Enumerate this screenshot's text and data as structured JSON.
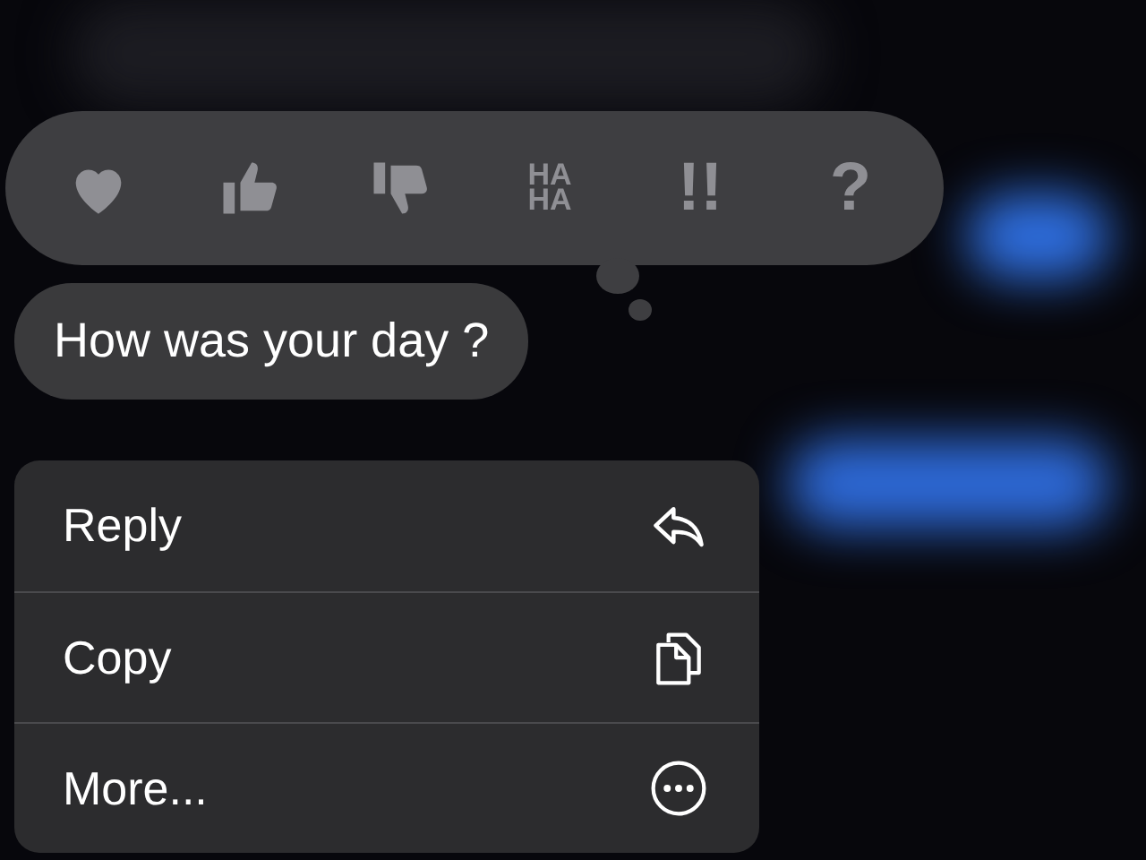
{
  "reactions": [
    {
      "kind": "heart"
    },
    {
      "kind": "thumbs-up"
    },
    {
      "kind": "thumbs-down"
    },
    {
      "kind": "text",
      "label": "HA HA"
    },
    {
      "kind": "text",
      "label": "!!"
    },
    {
      "kind": "text",
      "label": "?"
    }
  ],
  "message": {
    "text": "How was your day ?"
  },
  "menu": [
    {
      "label": "Reply",
      "kind": "reply"
    },
    {
      "label": "Copy",
      "kind": "copy"
    },
    {
      "label": "More...",
      "kind": "more"
    }
  ]
}
